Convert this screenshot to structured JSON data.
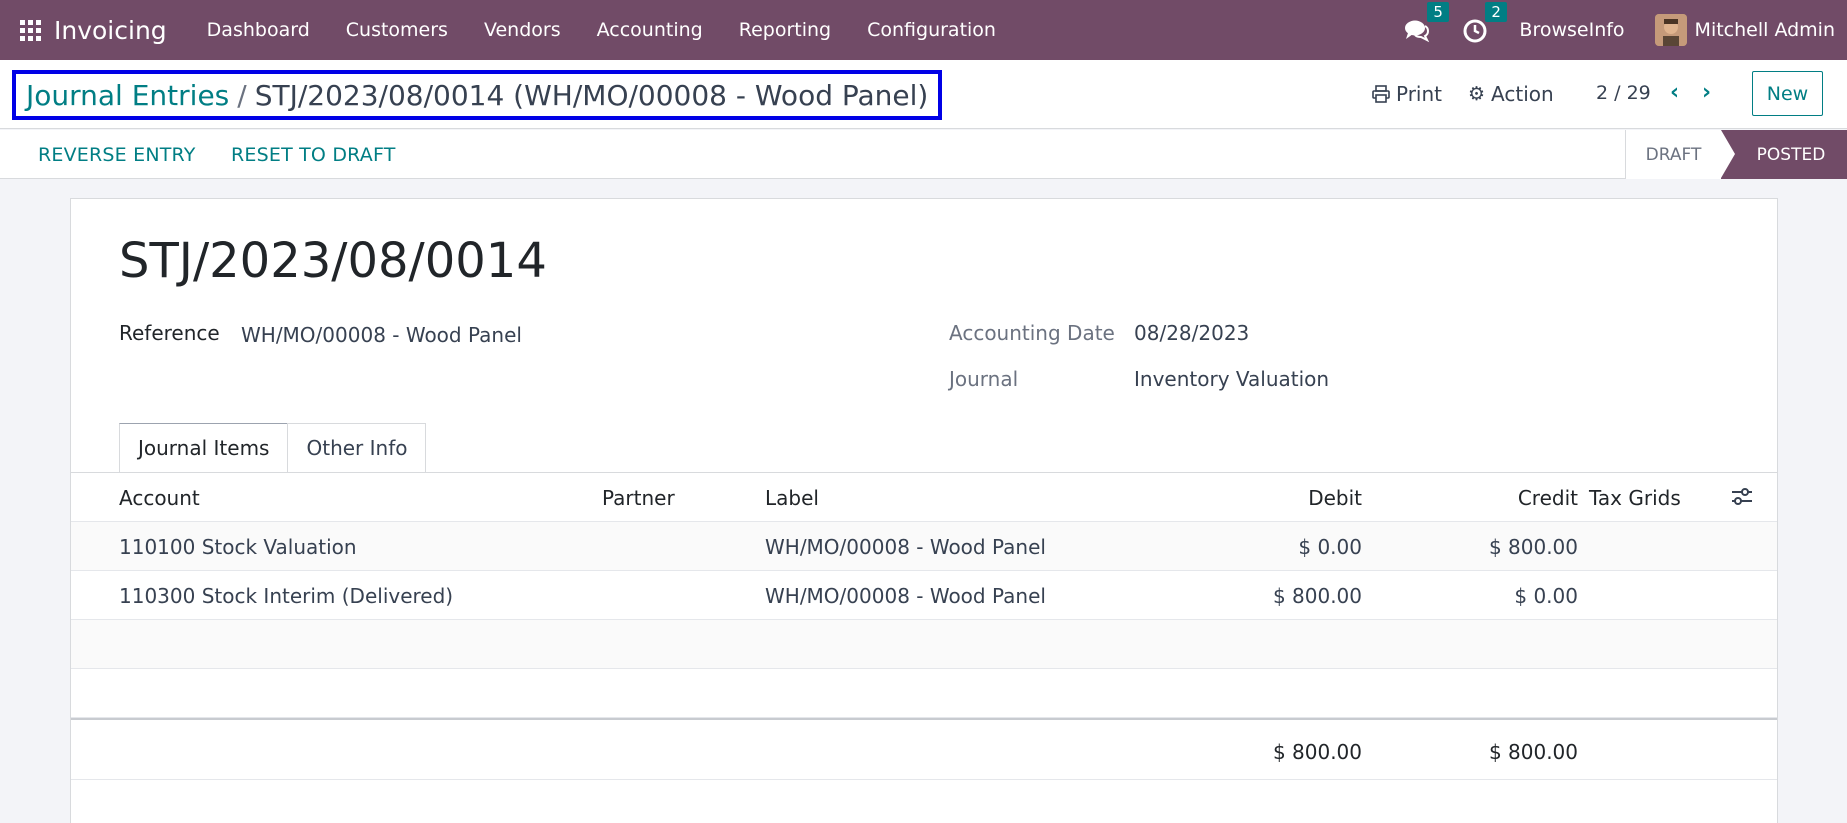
{
  "app": {
    "name": "Invoicing",
    "menu": [
      "Dashboard",
      "Customers",
      "Vendors",
      "Accounting",
      "Reporting",
      "Configuration"
    ],
    "messages_count": "5",
    "activities_count": "2",
    "company": "BrowseInfo",
    "user": "Mitchell Admin"
  },
  "control": {
    "breadcrumb_parent": "Journal Entries",
    "breadcrumb_sep": "/",
    "breadcrumb_current": "STJ/2023/08/0014 (WH/MO/00008 - Wood Panel)",
    "print_label": "Print",
    "action_label": "Action",
    "pager": "2 / 29",
    "new_label": "New"
  },
  "statusbar": {
    "reverse_label": "REVERSE ENTRY",
    "reset_label": "RESET TO DRAFT",
    "stage_draft": "DRAFT",
    "stage_posted": "POSTED"
  },
  "record": {
    "title": "STJ/2023/08/0014",
    "reference_label": "Reference",
    "reference_value": "WH/MO/00008 - Wood Panel",
    "date_label": "Accounting Date",
    "date_value": "08/28/2023",
    "journal_label": "Journal",
    "journal_value": "Inventory Valuation"
  },
  "tabs": [
    "Journal Items",
    "Other Info"
  ],
  "table": {
    "columns": [
      "Account",
      "Partner",
      "Label",
      "Debit",
      "Credit",
      "Tax Grids"
    ],
    "rows": [
      {
        "account": "110100 Stock Valuation",
        "partner": "",
        "label": "WH/MO/00008 - Wood Panel",
        "debit": "$ 0.00",
        "credit": "$ 800.00",
        "tax": ""
      },
      {
        "account": "110300 Stock Interim (Delivered)",
        "partner": "",
        "label": "WH/MO/00008 - Wood Panel",
        "debit": "$ 800.00",
        "credit": "$ 0.00",
        "tax": ""
      }
    ],
    "total_debit": "$ 800.00",
    "total_credit": "$ 800.00"
  },
  "colors": {
    "navbar": "#714b67",
    "accent": "#017e84",
    "highlight_border": "#0000e6"
  }
}
